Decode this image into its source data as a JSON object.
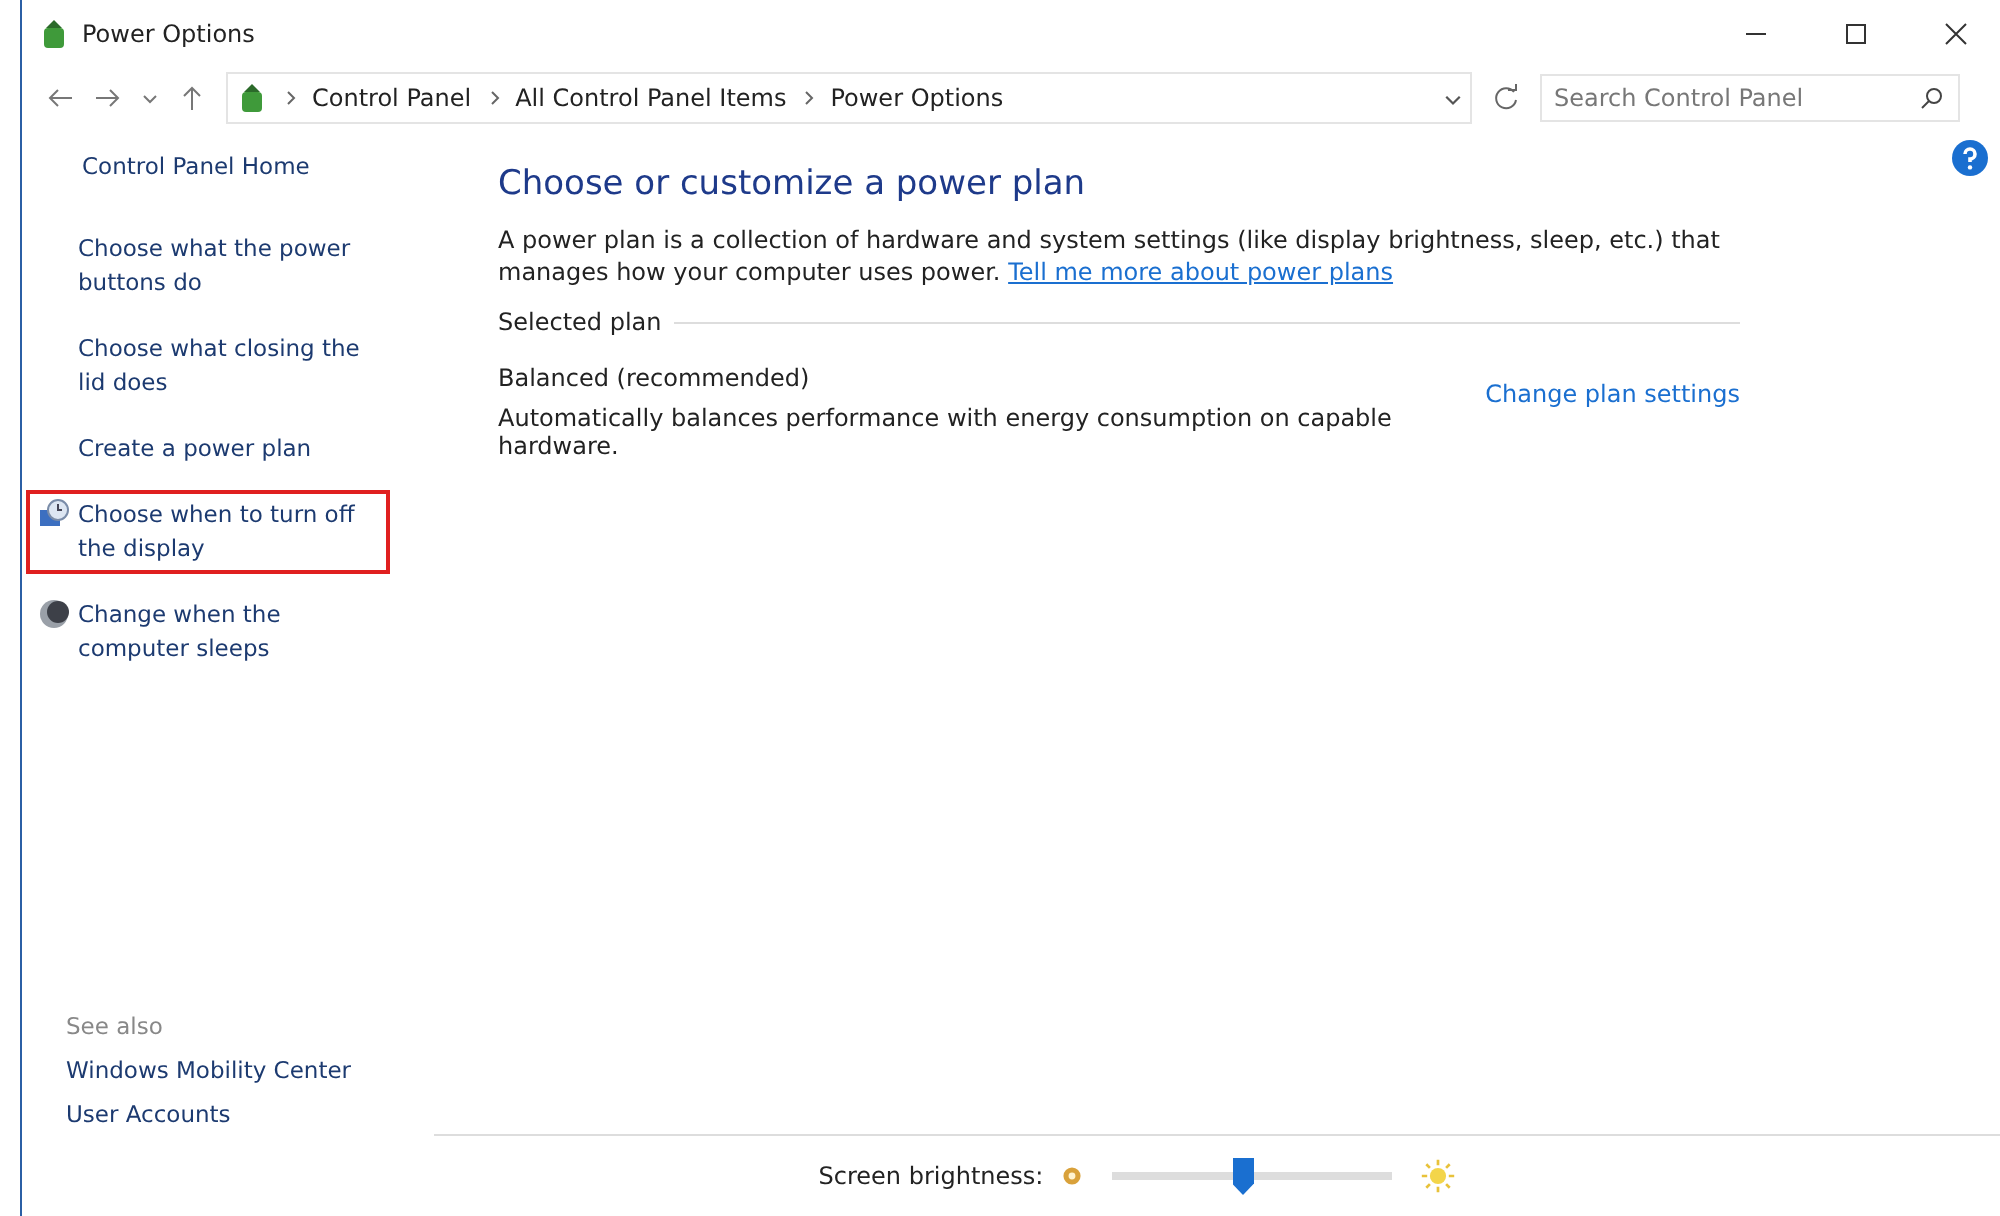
{
  "window": {
    "title": "Power Options"
  },
  "address_bar": {
    "path": [
      "Control Panel",
      "All Control Panel Items",
      "Power Options"
    ]
  },
  "search": {
    "placeholder": "Search Control Panel"
  },
  "sidebar": {
    "home": "Control Panel Home",
    "items": [
      {
        "label": "Choose what the power buttons do",
        "kind": "plain",
        "highlighted": false
      },
      {
        "label": "Choose what closing the lid does",
        "kind": "plain",
        "highlighted": false
      },
      {
        "label": "Create a power plan",
        "kind": "plain",
        "highlighted": false
      },
      {
        "label": "Choose when to turn off the display",
        "kind": "display",
        "highlighted": true
      },
      {
        "label": "Change when the computer sleeps",
        "kind": "sleep",
        "highlighted": false
      }
    ],
    "see_also": {
      "heading": "See also",
      "links": [
        "Windows Mobility Center",
        "User Accounts"
      ]
    }
  },
  "main": {
    "heading": "Choose or customize a power plan",
    "intro": "A power plan is a collection of hardware and system settings (like display brightness, sleep, etc.) that manages how your computer uses power.",
    "intro_link": "Tell me more about power plans",
    "section_label": "Selected plan",
    "plan": {
      "name": "Balanced (recommended)",
      "description": "Automatically balances performance with energy consumption on capable hardware.",
      "settings_link": "Change plan settings"
    }
  },
  "brightness": {
    "label": "Screen brightness:",
    "level": 0.47
  }
}
